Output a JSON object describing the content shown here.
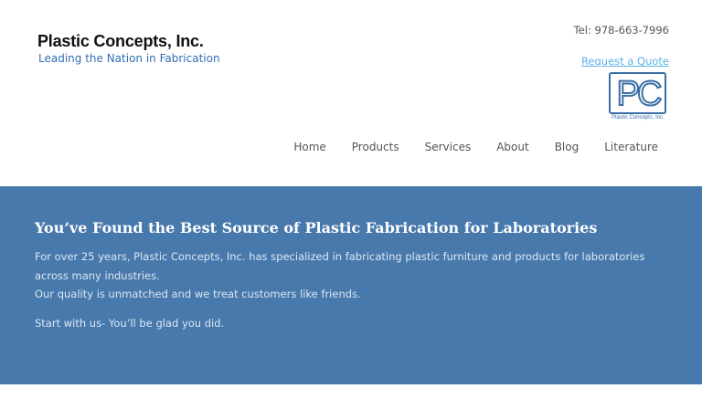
{
  "header": {
    "brand_name": "Plastic Concepts, Inc.",
    "tagline": "Leading the Nation in Fabrication",
    "phone": "Tel: 978-663-7996",
    "quote_link": "Request a Quote",
    "logo": {
      "letters": "PC",
      "caption": "Plastic Concepts, Inc."
    }
  },
  "nav": {
    "items": [
      "Home",
      "Products",
      "Services",
      "About",
      "Blog",
      "Literature"
    ]
  },
  "hero": {
    "heading": "You’ve Found the Best Source of Plastic Fabrication for Laboratories",
    "paragraph_1": "For over 25 years, Plastic Concepts, Inc. has specialized in fabricating plastic furniture and products for laboratories across many industries.",
    "paragraph_2": "Our quality is unmatched and we treat customers like friends.",
    "cta": "Start with us- You’ll be glad you did."
  },
  "colors": {
    "hero_background": "#4879ad",
    "brand_blue": "#2f6fb3",
    "link_blue": "#5bb3e6",
    "logo_blue": "#3c6fa6"
  }
}
